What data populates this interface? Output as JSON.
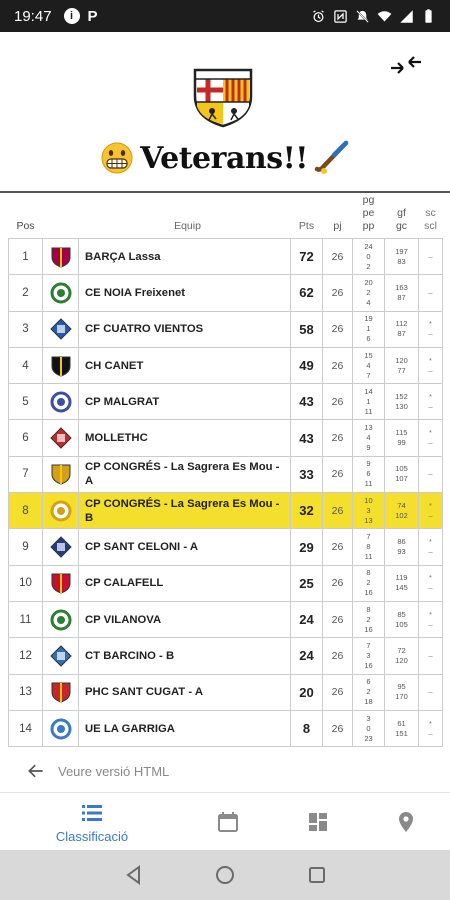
{
  "status_bar": {
    "time": "19:47",
    "notification_icons": [
      "info-icon",
      "parking-icon"
    ],
    "system_icons": [
      "alarm-icon",
      "nfc-icon",
      "mute-icon",
      "wifi-icon",
      "signal-icon",
      "battery-icon"
    ]
  },
  "header": {
    "title": "Veterans!!",
    "collapse_icon": "collapse-arrows-icon",
    "emoji": "grimacing-face",
    "sport_icon": "hockey-stick"
  },
  "table": {
    "headers": {
      "pos": "Pos",
      "team": "Equip",
      "pts": "Pts",
      "pj": "pj",
      "pgpp": [
        "pg",
        "pe",
        "pp"
      ],
      "gfgc": [
        "gf",
        "gc"
      ],
      "sc": [
        "sc",
        "scl"
      ]
    },
    "rows": [
      {
        "pos": "1",
        "team": "BARÇA Lassa",
        "pts": "72",
        "pj": "26",
        "pg": "24",
        "pe": "0",
        "pp": "2",
        "gf": "197",
        "gc": "83",
        "sc": "–",
        "scl": "",
        "highlight": false,
        "logo_color": "#a50044"
      },
      {
        "pos": "2",
        "team": "CE NOIA Freixenet",
        "pts": "62",
        "pj": "26",
        "pg": "20",
        "pe": "2",
        "pp": "4",
        "gf": "163",
        "gc": "87",
        "sc": "–",
        "scl": "",
        "highlight": false,
        "logo_color": "#2e7d32"
      },
      {
        "pos": "3",
        "team": "CF CUATRO VIENTOS",
        "pts": "58",
        "pj": "26",
        "pg": "19",
        "pe": "1",
        "pp": "6",
        "gf": "112",
        "gc": "87",
        "sc": "*",
        "scl": "–",
        "highlight": false,
        "logo_color": "#1e5bb8"
      },
      {
        "pos": "4",
        "team": "CH CANET",
        "pts": "49",
        "pj": "26",
        "pg": "15",
        "pe": "4",
        "pp": "7",
        "gf": "120",
        "gc": "77",
        "sc": "*",
        "scl": "–",
        "highlight": false,
        "logo_color": "#111111"
      },
      {
        "pos": "5",
        "team": "CP MALGRAT",
        "pts": "43",
        "pj": "26",
        "pg": "14",
        "pe": "1",
        "pp": "11",
        "gf": "152",
        "gc": "130",
        "sc": "*",
        "scl": "–",
        "highlight": false,
        "logo_color": "#3a4fa0"
      },
      {
        "pos": "6",
        "team": "MOLLETHC",
        "pts": "43",
        "pj": "26",
        "pg": "13",
        "pe": "4",
        "pp": "9",
        "gf": "115",
        "gc": "99",
        "sc": "*",
        "scl": "–",
        "highlight": false,
        "logo_color": "#c62828"
      },
      {
        "pos": "7",
        "team": "CP CONGRÉS - La Sagrera Es Mou - A",
        "pts": "33",
        "pj": "26",
        "pg": "9",
        "pe": "6",
        "pp": "11",
        "gf": "105",
        "gc": "107",
        "sc": "–",
        "scl": "",
        "highlight": false,
        "logo_color": "#d4a017"
      },
      {
        "pos": "8",
        "team": "CP CONGRÉS - La Sagrera Es Mou - B",
        "pts": "32",
        "pj": "26",
        "pg": "10",
        "pe": "3",
        "pp": "13",
        "gf": "74",
        "gc": "102",
        "sc": "*",
        "scl": "–",
        "highlight": true,
        "logo_color": "#d4a017"
      },
      {
        "pos": "9",
        "team": "CP SANT CELONI - A",
        "pts": "29",
        "pj": "26",
        "pg": "7",
        "pe": "8",
        "pp": "11",
        "gf": "86",
        "gc": "93",
        "sc": "*",
        "scl": "–",
        "highlight": false,
        "logo_color": "#1f3c88"
      },
      {
        "pos": "10",
        "team": "CP CALAFELL",
        "pts": "25",
        "pj": "26",
        "pg": "8",
        "pe": "2",
        "pp": "16",
        "gf": "119",
        "gc": "145",
        "sc": "*",
        "scl": "–",
        "highlight": false,
        "logo_color": "#c8102e"
      },
      {
        "pos": "11",
        "team": "CP VILANOVA",
        "pts": "24",
        "pj": "26",
        "pg": "8",
        "pe": "2",
        "pp": "16",
        "gf": "85",
        "gc": "105",
        "sc": "*",
        "scl": "–",
        "highlight": false,
        "logo_color": "#2e7d32"
      },
      {
        "pos": "12",
        "team": "CT BARCINO - B",
        "pts": "24",
        "pj": "26",
        "pg": "7",
        "pe": "3",
        "pp": "16",
        "gf": "72",
        "gc": "120",
        "sc": "–",
        "scl": "",
        "highlight": false,
        "logo_color": "#2d6fb8"
      },
      {
        "pos": "13",
        "team": "PHC SANT CUGAT - A",
        "pts": "20",
        "pj": "26",
        "pg": "6",
        "pe": "2",
        "pp": "18",
        "gf": "95",
        "gc": "170",
        "sc": "–",
        "scl": "",
        "highlight": false,
        "logo_color": "#c62828"
      },
      {
        "pos": "14",
        "team": "UE LA GARRIGA",
        "pts": "8",
        "pj": "26",
        "pg": "3",
        "pe": "0",
        "pp": "23",
        "gf": "61",
        "gc": "151",
        "sc": "*",
        "scl": "–",
        "highlight": false,
        "logo_color": "#3a78c9"
      }
    ]
  },
  "html_link": {
    "label": "Veure versió HTML",
    "icon": "arrow-left-icon"
  },
  "bottom_nav": {
    "items": [
      {
        "label": "Classificació",
        "icon": "list-icon",
        "active": true
      },
      {
        "label": "",
        "icon": "calendar-icon",
        "active": false
      },
      {
        "label": "",
        "icon": "grid-icon",
        "active": false
      },
      {
        "label": "",
        "icon": "location-icon",
        "active": false
      }
    ],
    "active_color": "#3a78c9",
    "inactive_color": "#8a8a8a"
  },
  "system_nav": {
    "icons": [
      "back-icon",
      "home-icon",
      "recents-icon"
    ]
  },
  "colors": {
    "highlight_row": "#f4e02c",
    "status_bar": "#1d1d1d",
    "system_nav": "#d9d9d9"
  }
}
